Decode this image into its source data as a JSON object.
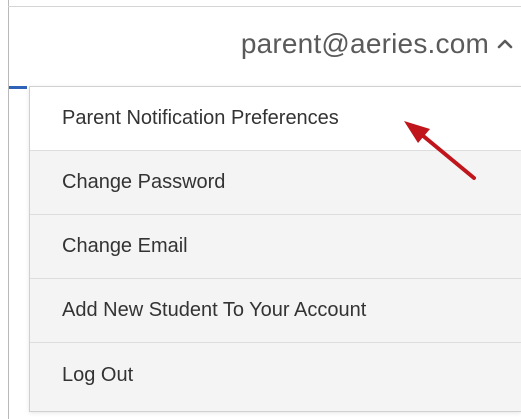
{
  "header": {
    "account_email": "parent@aeries.com",
    "toggle_icon": "chevron-up-icon"
  },
  "menu": {
    "items": [
      {
        "label": "Parent Notification Preferences",
        "highlighted": true
      },
      {
        "label": "Change Password",
        "highlighted": false
      },
      {
        "label": "Change Email",
        "highlighted": false
      },
      {
        "label": "Add New Student To Your Account",
        "highlighted": false
      },
      {
        "label": "Log Out",
        "highlighted": false
      }
    ]
  },
  "annotation": {
    "icon": "red-arrow-icon",
    "color": "#c0151b"
  },
  "colors": {
    "accent": "#2f63b8",
    "menu_background": "#f4f4f4",
    "highlight_background": "#ffffff",
    "text": "#333333"
  }
}
